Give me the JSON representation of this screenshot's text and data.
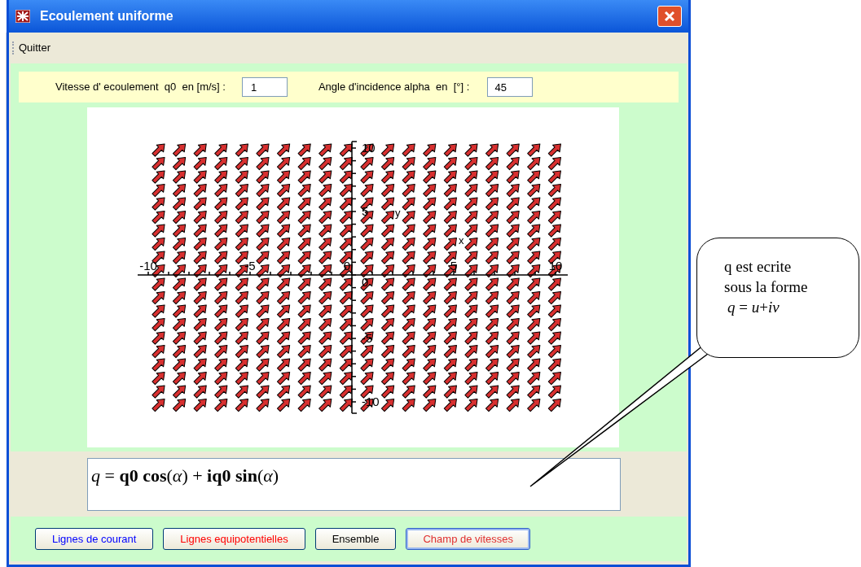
{
  "window": {
    "title": "Ecoulement uniforme"
  },
  "menu": [
    {
      "label": "Quitter"
    }
  ],
  "inputs": [
    {
      "label": "Vitesse d' ecoulement  q0  en [m/s] :",
      "value": "1"
    },
    {
      "label": "Angle d'incidence alpha  en  [°] :",
      "value": "45"
    }
  ],
  "plot": {
    "x_axis_label": "x",
    "y_axis_label": "y",
    "x_ticks": [
      "-10",
      "-5",
      "0",
      "5",
      "10"
    ],
    "y_ticks": [
      "10",
      "5",
      "0",
      "-5",
      "-10"
    ]
  },
  "formula": "*q* = **q0 cos**(*α*) + **iq0 sin**(*α*)",
  "buttons": [
    {
      "label": "Lignes de courant",
      "color": "#0000ff",
      "selected": false
    },
    {
      "label": "Lignes equipotentielles",
      "color": "#ff0000",
      "selected": false
    },
    {
      "label": "Ensemble",
      "color": "#000000",
      "selected": false
    },
    {
      "label": "Champ de vitesses",
      "color": "#e03030",
      "selected": true
    }
  ],
  "callout": {
    "text": "q est ecrite sous la forme",
    "formula": "*q* = *u*+*iv*"
  }
}
